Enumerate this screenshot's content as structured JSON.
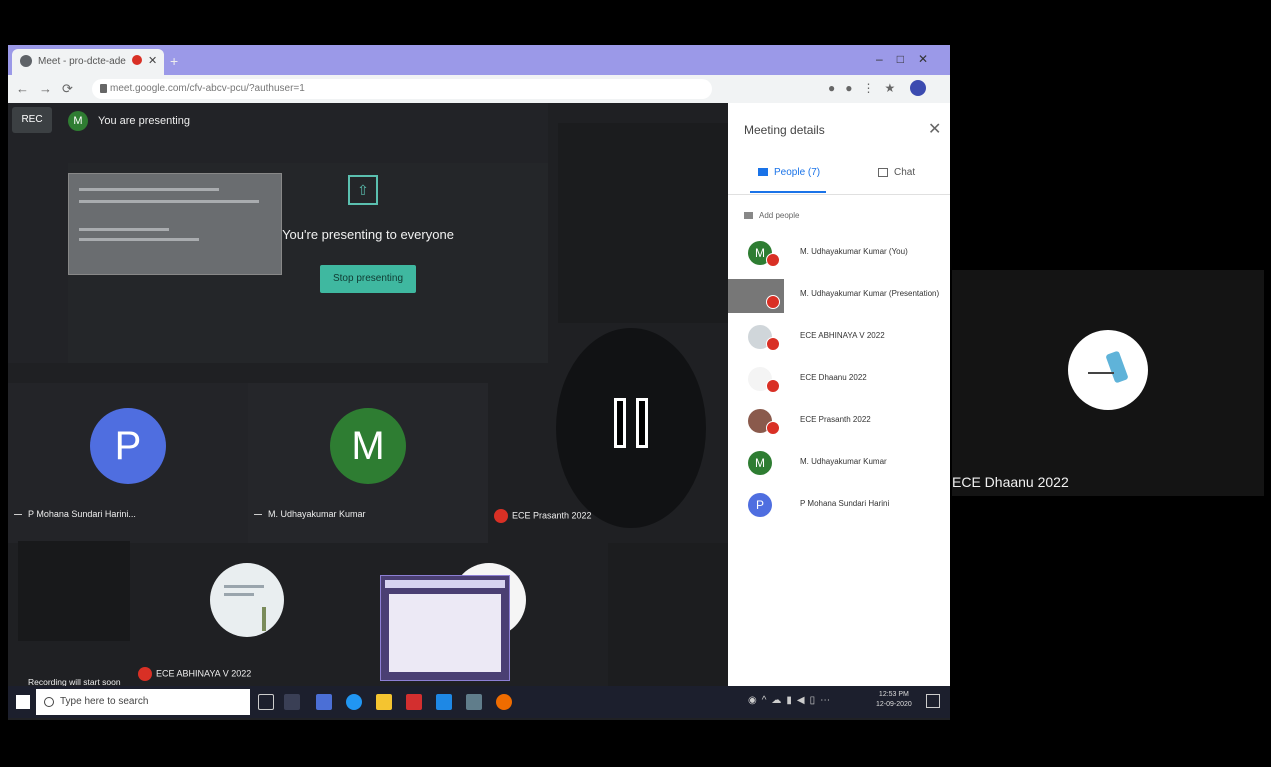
{
  "browser": {
    "tab_title": "Meet - pro-dcte-ade",
    "url": "meet.google.com/cfv-abcv-pcu/?authuser=1"
  },
  "meet": {
    "rec_label": "REC",
    "presenter_initial": "M",
    "presenting_label": "You are presenting",
    "present_icon": "present-screen-icon",
    "presenting_text": "You're presenting to everyone",
    "stop_button": "Stop presenting",
    "tiles": [
      {
        "initial": "P",
        "name": "P Mohana Sundari Harini...",
        "color": "#4f6ee0"
      },
      {
        "initial": "M",
        "name": "M. Udhayakumar Kumar",
        "color": "#2e7d32"
      },
      {
        "name": "ECE Prasanth 2022"
      }
    ],
    "bottom_tiles": [
      {
        "name": "ECE ABHINAYA V 2022"
      }
    ],
    "recording_toast": "Recording will start soon"
  },
  "sidebar": {
    "title": "Meeting details",
    "people_tab": "People (7)",
    "chat_tab": "Chat",
    "add_people": "Add people",
    "participants": [
      {
        "initial": "M",
        "name": "M. Udhayakumar Kumar (You)",
        "color": "#2e7d32"
      },
      {
        "initial": "",
        "name": "M. Udhayakumar Kumar (Presentation)",
        "color": "#777"
      },
      {
        "initial": "",
        "name": "ECE ABHINAYA V 2022",
        "color": "#d0d6da"
      },
      {
        "initial": "",
        "name": "ECE Dhaanu 2022",
        "color": "#f4f4f4"
      },
      {
        "initial": "",
        "name": "ECE Prasanth 2022",
        "color": "#8a5a4c"
      },
      {
        "initial": "M",
        "name": "M. Udhayakumar Kumar",
        "color": "#2e7d32"
      },
      {
        "initial": "P",
        "name": "P Mohana Sundari Harini",
        "color": "#4f6ee0"
      }
    ]
  },
  "taskbar": {
    "search_placeholder": "Type here to search",
    "clock_time": "12:53 PM",
    "clock_date": "12-09-2020"
  },
  "right_panel": {
    "name": "ECE Dhaanu 2022"
  }
}
